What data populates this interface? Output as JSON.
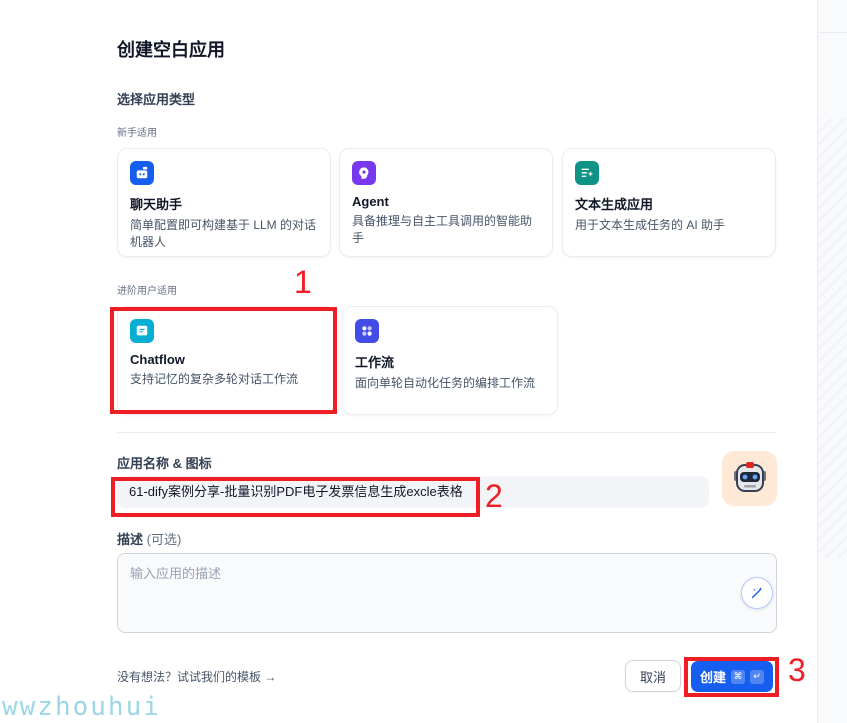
{
  "dialog": {
    "title": "创建空白应用",
    "section_app_type": "选择应用类型",
    "group_beginner": "新手适用",
    "group_advanced": "进阶用户适用"
  },
  "app_types": {
    "chatbot": {
      "name": "聊天助手",
      "desc": "简单配置即可构建基于 LLM 的对话机器人",
      "icon": "chat-bot-icon"
    },
    "agent": {
      "name": "Agent",
      "desc": "具备推理与自主工具调用的智能助手",
      "icon": "agent-icon"
    },
    "completion": {
      "name": "文本生成应用",
      "desc": "用于文本生成任务的 AI 助手",
      "icon": "text-generation-icon"
    },
    "chatflow": {
      "name": "Chatflow",
      "desc": "支持记忆的复杂多轮对话工作流",
      "icon": "chatflow-icon"
    },
    "workflow": {
      "name": "工作流",
      "desc": "面向单轮自动化任务的编排工作流",
      "icon": "workflow-icon"
    }
  },
  "form": {
    "name_label": "应用名称 & 图标",
    "name_value": "61-dify案例分享-批量识别PDF电子发票信息生成excle表格",
    "desc_label": "描述",
    "desc_optional": "(可选)",
    "desc_placeholder": "输入应用的描述"
  },
  "footer": {
    "templates_link": "没有想法？试试我们的模板 →",
    "cancel_label": "取消",
    "create_label": "创建",
    "shortcut_cmd": "⌘",
    "shortcut_enter": "↵"
  },
  "annotations": [
    "1",
    "2",
    "3"
  ],
  "watermark": "wwzhouhui",
  "colors": {
    "accent": "#155eef",
    "annotation": "#ef1d24",
    "app_icon_bg": "#fde9d5"
  }
}
